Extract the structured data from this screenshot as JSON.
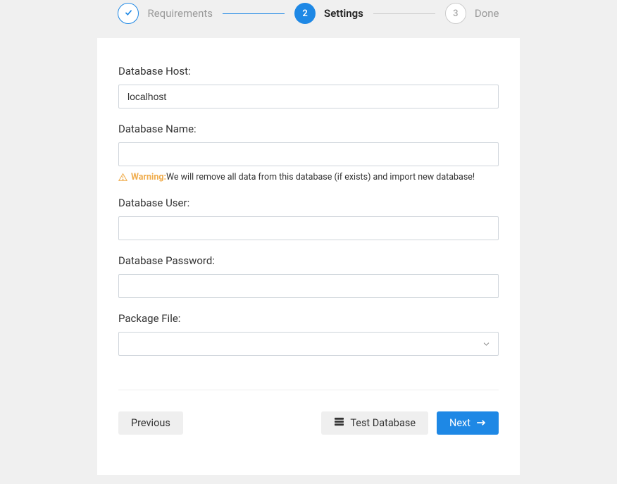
{
  "stepper": {
    "steps": [
      {
        "label": "Requirements",
        "state": "completed"
      },
      {
        "num": "2",
        "label": "Settings",
        "state": "current"
      },
      {
        "num": "3",
        "label": "Done",
        "state": "pending"
      }
    ]
  },
  "form": {
    "db_host": {
      "label": "Database Host:",
      "value": "localhost"
    },
    "db_name": {
      "label": "Database Name:",
      "value": ""
    },
    "db_name_warning": {
      "prefix": "Warning:",
      "text": "We will remove all data from this database (if exists) and import new database!"
    },
    "db_user": {
      "label": "Database User:",
      "value": ""
    },
    "db_password": {
      "label": "Database Password:",
      "value": ""
    },
    "package_file": {
      "label": "Package File:",
      "selected": ""
    }
  },
  "actions": {
    "previous": "Previous",
    "test_db": "Test Database",
    "next": "Next"
  }
}
